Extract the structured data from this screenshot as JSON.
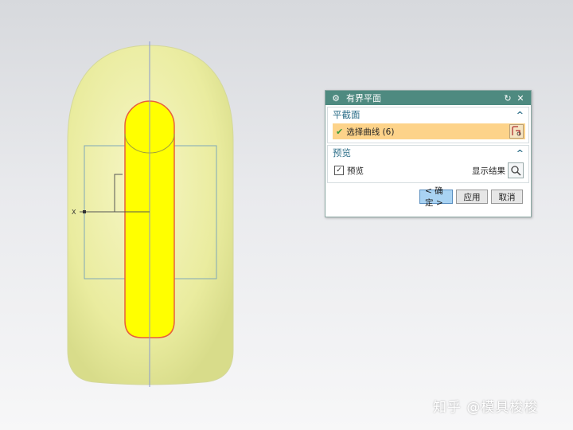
{
  "viewport": {
    "axis_label": "X",
    "colors": {
      "body": "#eff0b4",
      "face": "#ffff00",
      "outline": "#e8603c",
      "plane": "#7fa8b8"
    }
  },
  "dialog": {
    "title": "有界平面",
    "section_cut": {
      "title": "平截面",
      "select_label": "选择曲线 (6)"
    },
    "section_preview": {
      "title": "预览",
      "preview_label": "预览",
      "preview_checked": true,
      "show_result_label": "显示结果"
    },
    "buttons": {
      "ok": "< 确定 >",
      "apply": "应用",
      "cancel": "取消"
    }
  },
  "watermark": {
    "text": "知乎 @模具梭梭"
  }
}
